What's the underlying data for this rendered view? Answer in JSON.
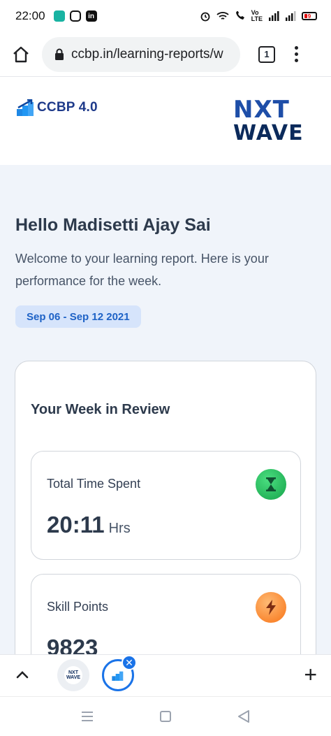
{
  "status_bar": {
    "time": "22:00",
    "battery": "9"
  },
  "browser": {
    "url": "ccbp.in/learning-reports/w",
    "tab_count": "1"
  },
  "header": {
    "ccbp_logo_text": "CCBP 4.0",
    "nxt_logo_line1": "NXT",
    "nxt_logo_line2": "WAVE"
  },
  "report": {
    "greeting": "Hello Madisetti Ajay Sai",
    "welcome_text": "Welcome to your learning report. Here is your performance for the week.",
    "date_range": "Sep 06 - Sep 12 2021",
    "section_title": "Your Week in Review",
    "stats": [
      {
        "label": "Total Time Spent",
        "value": "20:11",
        "unit": "Hrs",
        "icon": "hourglass-icon",
        "color": "#22c55e"
      },
      {
        "label": "Skill Points",
        "value": "9823",
        "unit": "",
        "icon": "lightning-icon",
        "color": "#f97316"
      }
    ]
  },
  "tab_bar": {
    "thumb_a_text": "NXT WAVE"
  }
}
